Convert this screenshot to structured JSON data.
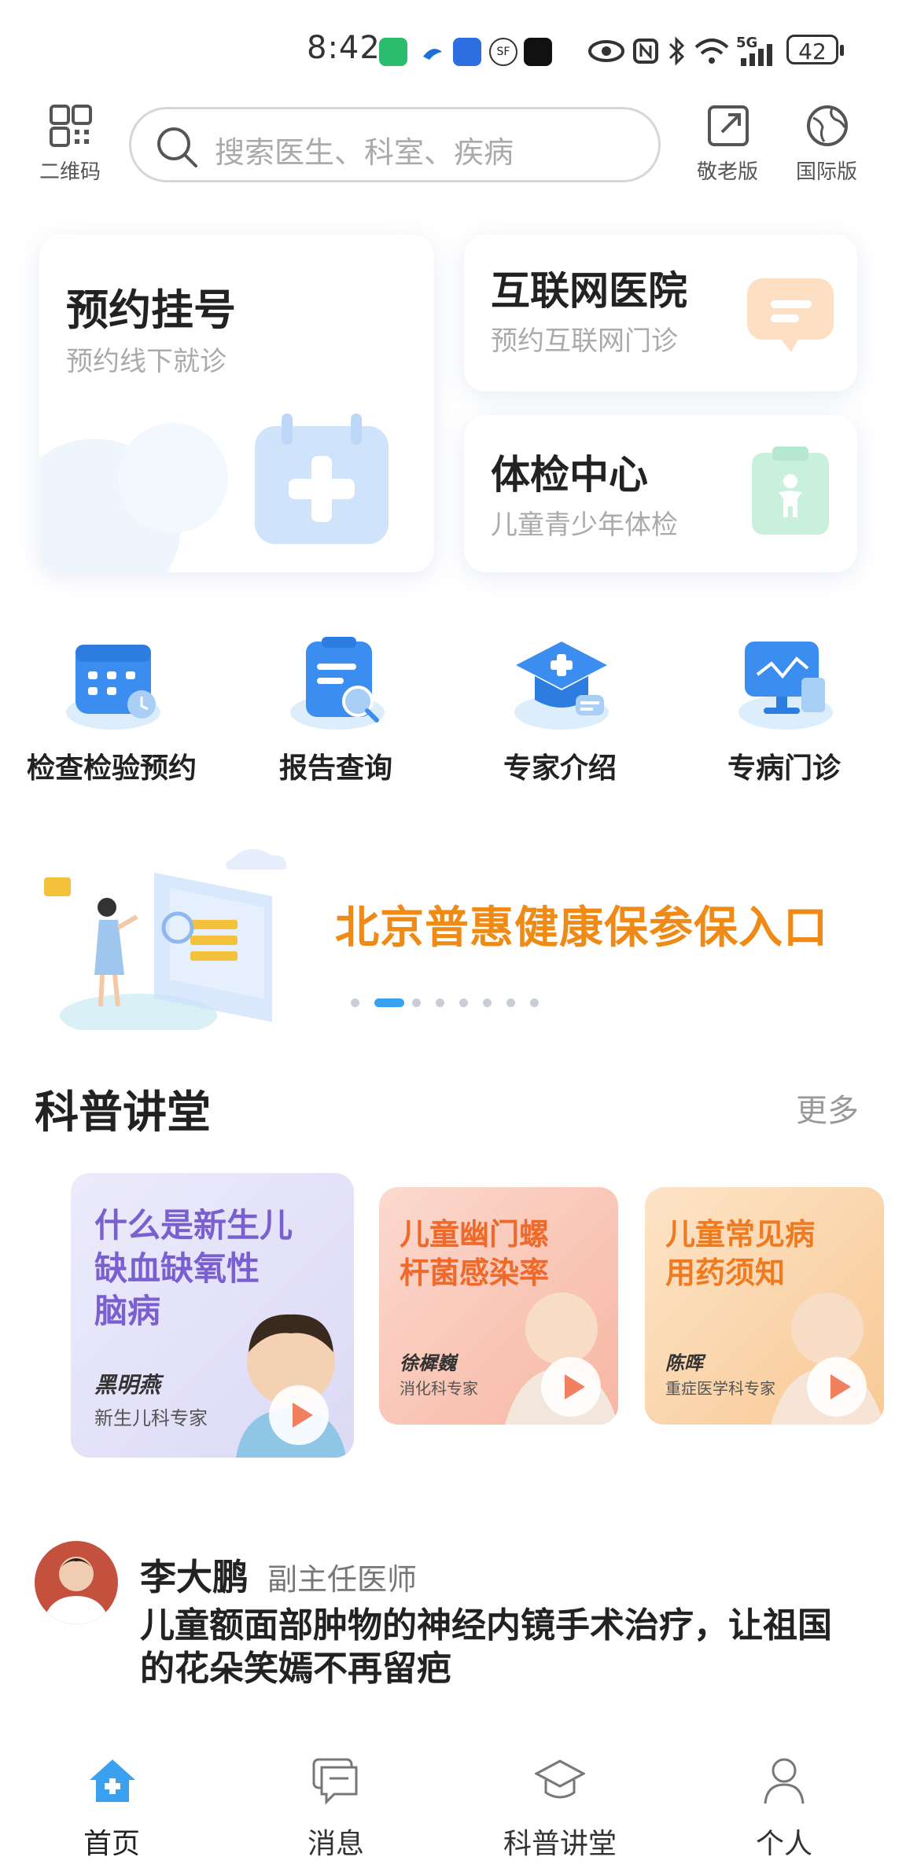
{
  "status_bar": {
    "time": "8:42",
    "network": "5G",
    "battery": "42"
  },
  "header": {
    "qr_label": "二维码",
    "search_placeholder": "搜索医生、科室、疾病",
    "elder_label": "敬老版",
    "intl_label": "国际版"
  },
  "cards": {
    "appointment": {
      "title": "预约挂号",
      "subtitle": "预约线下就诊"
    },
    "internet_hospital": {
      "title": "互联网医院",
      "subtitle": "预约互联网门诊"
    },
    "checkup": {
      "title": "体检中心",
      "subtitle": "儿童青少年体检"
    }
  },
  "services": [
    {
      "label": "检查检验预约",
      "icon": "calendar-icon"
    },
    {
      "label": "报告查询",
      "icon": "report-search-icon"
    },
    {
      "label": "专家介绍",
      "icon": "graduation-cap-icon"
    },
    {
      "label": "专病门诊",
      "icon": "monitor-icon"
    }
  ],
  "banner": {
    "text": "北京普惠健康保参保入口",
    "slide_count": 8,
    "active_slide": 2
  },
  "science": {
    "title": "科普讲堂",
    "more": "更多",
    "items": [
      {
        "title_line1": "什么是新生儿",
        "title_line2": "缺血缺氧性",
        "title_line3": "脑病",
        "doctor": "黑明燕",
        "dept": "新生儿科专家"
      },
      {
        "title_line1": "儿童幽门螺",
        "title_line2": "杆菌感染率",
        "doctor": "徐樨巍",
        "dept": "消化科专家"
      },
      {
        "title_line1": "儿童常见病",
        "title_line2": "用药须知",
        "doctor": "陈晖",
        "dept": "重症医学科专家"
      }
    ]
  },
  "post": {
    "doctor_name": "李大鹏",
    "doctor_title": "副主任医师",
    "headline": "儿童额面部肿物的神经内镜手术治疗，让祖国的花朵笑嫣不再留疤"
  },
  "tabbar": [
    {
      "label": "首页",
      "icon": "home-icon",
      "active": true
    },
    {
      "label": "消息",
      "icon": "message-icon",
      "active": false
    },
    {
      "label": "科普讲堂",
      "icon": "graduation-cap-icon",
      "active": false
    },
    {
      "label": "个人",
      "icon": "user-icon",
      "active": false
    }
  ],
  "colors": {
    "accent_blue": "#3aa0f0",
    "banner_orange": "#f08a16",
    "purple_tile": "#7a5fd0",
    "orange_tile": "#ef6a2a"
  }
}
